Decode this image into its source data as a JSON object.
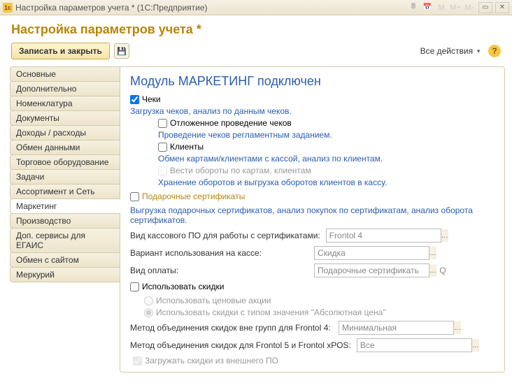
{
  "titlebar": {
    "title": "Настройка параметров учета * (1С:Предприятие)"
  },
  "header": {
    "title": "Настройка параметров учета *"
  },
  "toolbar": {
    "save_and_close": "Записать и закрыть",
    "all_actions": "Все действия"
  },
  "sidebar": {
    "tabs": [
      "Основные",
      "Дополнительно",
      "Номенклатура",
      "Документы",
      "Доходы / расходы",
      "Обмен данными",
      "Торговое оборудование",
      "Задачи",
      "Ассортимент и Сеть",
      "Маркетинг",
      "Производство",
      "Доп. сервисы для ЕГАИС",
      "Обмен с сайтом",
      "Меркурий"
    ],
    "active_index": 9
  },
  "main": {
    "module_title": "Модуль МАРКЕТИНГ подключен",
    "checks_label": "Чеки",
    "checks_desc": "Загрузка чеков, анализ по данным чеков.",
    "deferred_label": "Отложенное проведение чеков",
    "deferred_link": "Проведение чеков регламентным заданием.",
    "clients_label": "Клиенты",
    "clients_link": "Обмен картами/клиентами с кассой, анализ по клиентам.",
    "turnover_label": "Вести обороты по картам, клиентам",
    "turnover_link": "Хранение оборотов и выгрузка оборотов клиентов в кассу.",
    "gift_label": "Подарочные сертификаты",
    "gift_desc": "Выгрузка подарочных сертификатов, анализ покупок по сертификатам, анализ оборота сертификатов.",
    "field_kasso": "Вид кассового ПО для работы с сертификатами:",
    "field_kasso_value": "Frontol 4",
    "field_variant": "Вариант использования на кассе:",
    "field_variant_value": "Скидка",
    "field_payment": "Вид оплаты:",
    "field_payment_value": "Подарочные сертификать",
    "use_discounts_label": "Использовать скидки",
    "radio_price": "Использовать ценовые акции",
    "radio_abs": "Использовать скидки с типом значения \"Абсолютная цена\"",
    "method_outside": "Метод объединения скидок вне групп для Frontol 4:",
    "method_outside_value": "Минимальная",
    "method_frontol5": "Метод объединения скидок для Frontol 5 и Frontol xPOS:",
    "method_frontol5_value": "Все",
    "load_external": "Загружать скидки из внешнего ПО"
  }
}
